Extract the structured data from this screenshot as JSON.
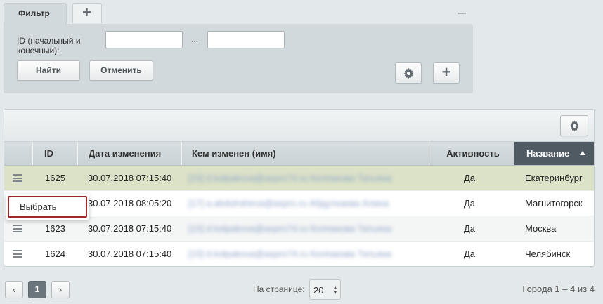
{
  "filter": {
    "tab_label": "Фильтр",
    "add_tab_label": "+",
    "id_label": "ID (начальный и конечный):",
    "id_from_value": "",
    "id_to_value": "",
    "range_separator": "...",
    "find_label": "Найти",
    "cancel_label": "Отменить",
    "add_label": "+"
  },
  "grid": {
    "columns": [
      "ID",
      "Дата изменения",
      "Кем изменен (имя)",
      "Активность",
      "Название"
    ],
    "sorted_column": "Название",
    "sort_direction": "asc",
    "rows": [
      {
        "id": "1625",
        "date": "30.07.2018 07:15:40",
        "who": "[15] d.kolpakova@aspro74.ru Колпакова Татьяна",
        "active": "Да",
        "name": "Екатеринбург",
        "selected": true
      },
      {
        "id": "",
        "date": "30.07.2018 08:05:20",
        "who": "[17] a.abdulraheva@aspro.ru Абдулхаева Алина",
        "active": "Да",
        "name": "Магнитогорск",
        "selected": false
      },
      {
        "id": "1623",
        "date": "30.07.2018 07:15:40",
        "who": "[15] d.kolpakova@aspro74.ru Колпакова Татьяна",
        "active": "Да",
        "name": "Москва",
        "selected": false
      },
      {
        "id": "1624",
        "date": "30.07.2018 07:15:40",
        "who": "[15] d.kolpakova@aspro74.ru Колпакова Татьяна",
        "active": "Да",
        "name": "Челябинск",
        "selected": false
      }
    ]
  },
  "context_menu": {
    "item_label": "Выбрать"
  },
  "footer": {
    "prev_label": "‹",
    "current_page": "1",
    "next_label": "›",
    "per_page_label": "На странице:",
    "per_page_value": "20",
    "total_label": "Города 1 – 4 из 4"
  },
  "icons": {
    "settings": "gear-icon",
    "row_menu": "hamburger-icon",
    "sort": "sort-asc-icon"
  },
  "colors": {
    "sorted_header": "#4f5a63",
    "selected_row": "#dbe2c8",
    "menu_border": "#9c2a2a"
  }
}
